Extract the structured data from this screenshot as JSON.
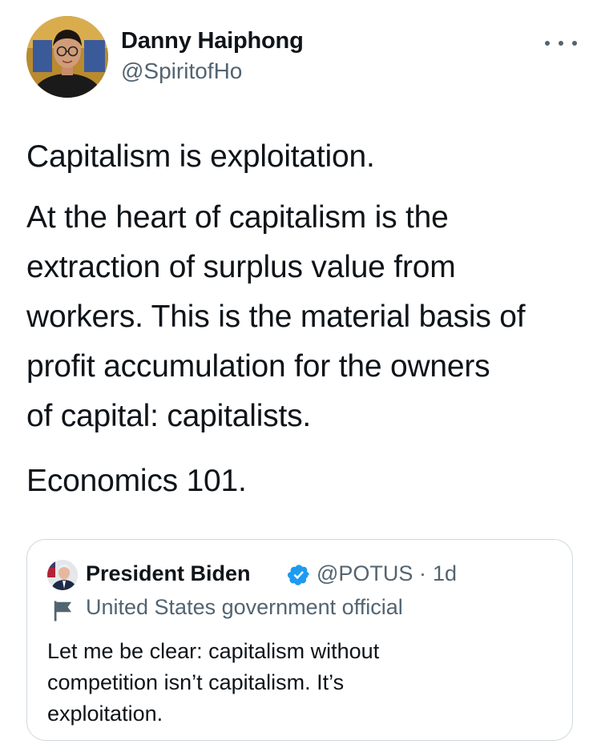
{
  "tweet": {
    "author": {
      "name": "Danny Haiphong",
      "handle": "@SpiritofHo",
      "avatar_icon": "avatar-photo"
    },
    "more_icon": "more-horizontal-icon",
    "paragraphs": [
      "Capitalism is exploitation.",
      "At the heart of capitalism is the\nextraction of surplus value from\nworkers. This is the material basis of\nprofit accumulation for the owners\nof capital: capitalists.",
      "Economics 101."
    ]
  },
  "quoted_tweet": {
    "author": {
      "name": "President Biden",
      "handle": "@POTUS",
      "separator": "·",
      "time": "1d",
      "verified_icon": "verified-badge-icon",
      "verified_color": "#1d9bf0"
    },
    "label": "United States government official",
    "label_icon": "flag-icon",
    "text": "Let me be clear: capitalism without\ncompetition isn’t capitalism. It’s\nexploitation."
  },
  "colors": {
    "text": "#0f1419",
    "secondary": "#536471",
    "border": "#cfd9de",
    "accent": "#1d9bf0"
  }
}
